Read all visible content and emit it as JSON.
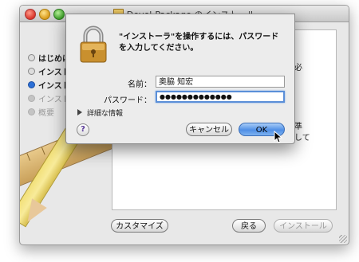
{
  "window": {
    "title": "Devel-Package のインストール"
  },
  "sidebar": {
    "items": [
      {
        "label": "はじめに",
        "state": "done"
      },
      {
        "label": "インスト",
        "state": "done"
      },
      {
        "label": "インスト",
        "state": "active"
      },
      {
        "label": "インスト",
        "state": "dim"
      },
      {
        "label": "概要",
        "state": "dim"
      }
    ]
  },
  "content": {
    "fragment_1": "必",
    "fragment_2": "準",
    "fragment_3": "して"
  },
  "buttons": {
    "customize": "カスタマイズ",
    "back": "戻る",
    "install": "インストール"
  },
  "auth": {
    "message": "\"インストーラ\"を操作するには、パスワードを入力してください。",
    "name_label": "名前：",
    "name_value": "奥脇 知宏",
    "password_label": "パスワード：",
    "password_value": "●●●●●●●●●●●●●",
    "details_label": "詳細な情報",
    "help_label": "?",
    "cancel_label": "キャンセル",
    "ok_label": "OK"
  },
  "colors": {
    "accent": "#4f8fe6",
    "active_step": "#2b6fd6"
  }
}
